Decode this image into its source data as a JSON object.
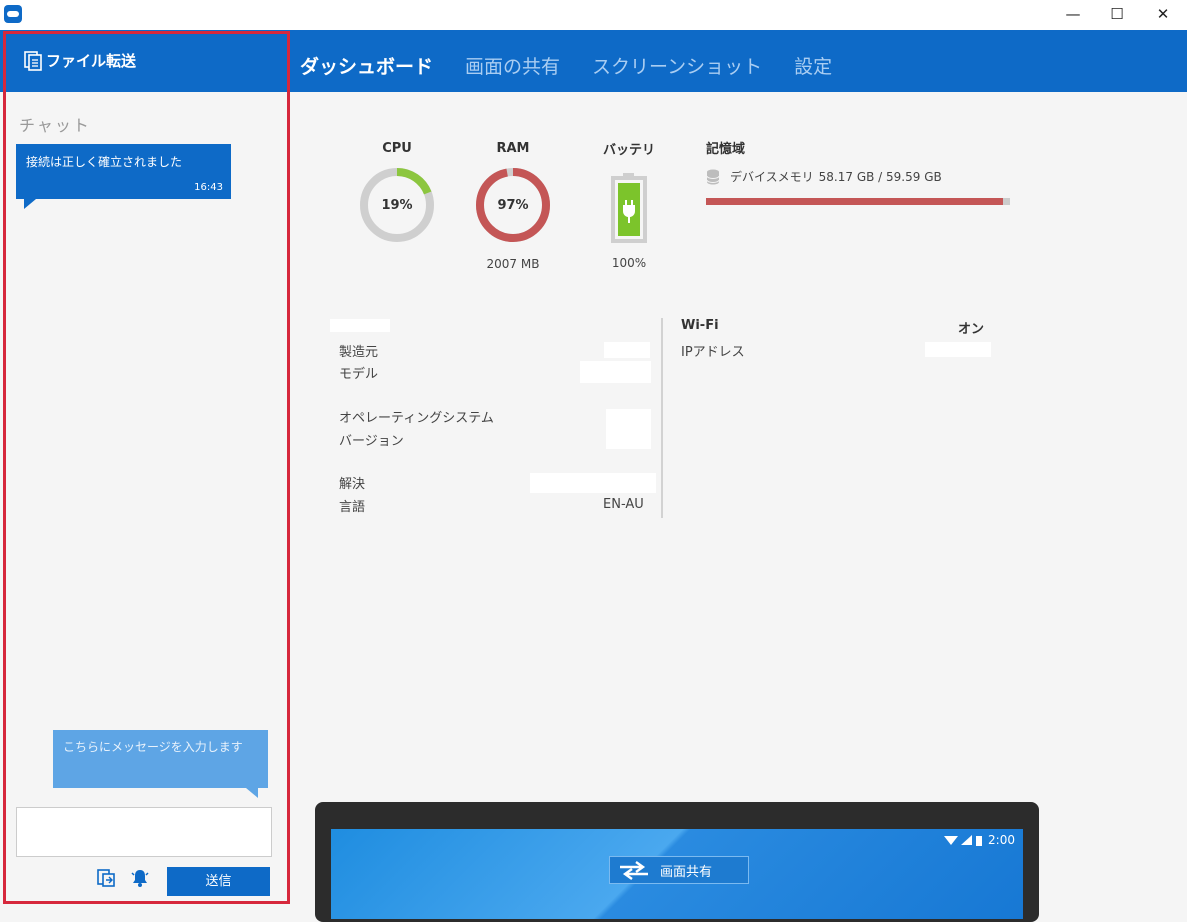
{
  "window": {
    "minimize": "—",
    "maximize": "☐",
    "close": "✕"
  },
  "header": {
    "file_transfer": "ファイル転送",
    "tabs": [
      {
        "label": "ダッシュボード",
        "active": true
      },
      {
        "label": "画面の共有",
        "active": false
      },
      {
        "label": "スクリーンショット",
        "active": false
      },
      {
        "label": "設定",
        "active": false
      }
    ]
  },
  "chat": {
    "title": "チャット",
    "messages": [
      {
        "text": "接続は正しく確立されました",
        "time": "16:43"
      }
    ],
    "placeholder_hint": "こちらにメッセージを入力します",
    "input_value": "",
    "send_label": "送信"
  },
  "dashboard": {
    "cpu": {
      "label": "CPU",
      "value": "19%",
      "fraction": 0.19,
      "color": "#8cc63f"
    },
    "ram": {
      "label": "RAM",
      "value": "97%",
      "fraction": 0.97,
      "sub": "2007 MB",
      "color": "#c45656"
    },
    "battery": {
      "label": "バッテリ",
      "value": "100%",
      "fraction": 1.0,
      "color": "#7cc42b"
    },
    "storage": {
      "title": "記憶域",
      "name": "デバイスメモリ",
      "used": "58.17 GB",
      "total": "59.59 GB",
      "fraction": 0.976,
      "separator": " / "
    },
    "device_info": {
      "manufacturer_label": "製造元",
      "model_label": "モデル",
      "os_label": "オペレーティングシステム",
      "version_label": "バージョン",
      "resolution_label": "解決",
      "language_label": "言語",
      "language_value": "EN-AU"
    },
    "wifi": {
      "title": "Wi-Fi",
      "status": "オン",
      "ip_label": "IPアドレス"
    }
  },
  "device_preview": {
    "time": "2:00",
    "share_label": "画面共有"
  },
  "colors": {
    "brand": "#0e6ac7",
    "frame": "#d6283c"
  }
}
